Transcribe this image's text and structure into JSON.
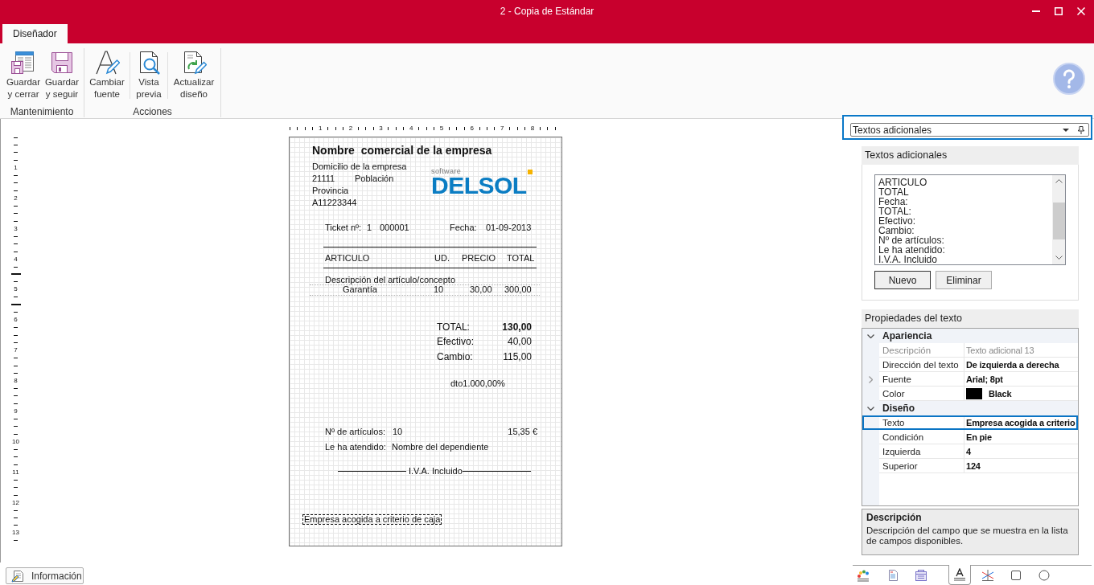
{
  "window": {
    "title": "2 - Copia de Estándar"
  },
  "tabs": [
    {
      "label": "Diseñador",
      "selected": true
    }
  ],
  "ribbon": {
    "groups": [
      {
        "label": "Mantenimiento",
        "buttons": [
          {
            "lines": [
              "Guardar",
              "y cerrar"
            ]
          },
          {
            "lines": [
              "Guardar",
              "y seguir"
            ]
          }
        ]
      },
      {
        "label": "Acciones",
        "buttons": [
          {
            "lines": [
              "Cambiar",
              "fuente"
            ]
          },
          {
            "lines": [
              "Vista",
              "previa"
            ]
          },
          {
            "lines": [
              "Actualizar",
              "diseño"
            ]
          }
        ]
      }
    ]
  },
  "rulers": {
    "horizontal": [
      "1",
      "2",
      "3",
      "4",
      "5",
      "6",
      "7",
      "8"
    ],
    "vertical": [
      "1",
      "2",
      "3",
      "4",
      "5",
      "6",
      "7",
      "8",
      "9",
      "10",
      "11",
      "12",
      "13"
    ]
  },
  "ticket": {
    "company_name": "Nombre  comercial de la empresa",
    "address": "Domicilio de la empresa",
    "postal_code": "21111",
    "city": "Población",
    "province": "Provincia",
    "tax_id": "A11223344",
    "logo": {
      "tagline": "software",
      "wordmark": "DELSOL"
    },
    "ticket_label": "Ticket nº:",
    "series": "1",
    "number": "000001",
    "date_label": "Fecha:",
    "date": "01-09-2013",
    "columns": [
      "ARTICULO",
      "UD.",
      "PRECIO",
      "TOTAL"
    ],
    "lines": [
      {
        "description": "Descripción del artículo/concepto",
        "name": "Garantía",
        "units": "10",
        "price": "30,00",
        "total": "300,00"
      }
    ],
    "totals": [
      {
        "label": "TOTAL:",
        "value": "130,00",
        "bold": true
      },
      {
        "label": "Efectivo:",
        "value": "40,00",
        "bold": false
      },
      {
        "label": "Cambio:",
        "value": "115,00",
        "bold": false
      }
    ],
    "discount": "dto1.000,00%",
    "items_count_label": "Nº de artículos:",
    "items_count": "10",
    "amount": "15,35 €",
    "served_by_label": "Le ha atendido:",
    "served_by": "Nombre del dependiente",
    "tax_note": "I.V.A. Incluido",
    "footer_text": {
      "text": "Empresa acogida a criterio de caja",
      "selected": true
    }
  },
  "panel_selector": {
    "value": "Textos adicionales",
    "highlighted": true
  },
  "additional_texts": {
    "title": "Textos adicionales",
    "items": [
      "ARTICULO",
      "TOTAL",
      "Fecha:",
      "TOTAL:",
      "Efectivo:",
      "Cambio:",
      "Nº de artículos:",
      "Le ha atendido:",
      "I.V.A. Incluido"
    ],
    "buttons": [
      {
        "label": "Nuevo",
        "focused": true
      },
      {
        "label": "Eliminar",
        "focused": false
      }
    ]
  },
  "properties": {
    "title": "Propiedades del texto",
    "categories": [
      {
        "name": "Apariencia",
        "expanded": true,
        "rows": [
          {
            "kind": "text",
            "name": "Descripción",
            "value": "Texto adicional 13",
            "readonly": true,
            "selected": false
          },
          {
            "kind": "text",
            "name": "Dirección del texto",
            "value": "De izquierda a derecha",
            "readonly": false,
            "selected": false
          },
          {
            "kind": "expandable",
            "name": "Fuente",
            "value": "Arial; 8pt",
            "expanded": false,
            "readonly": false,
            "selected": false
          },
          {
            "kind": "color",
            "name": "Color",
            "value": "Black",
            "color": "#000000",
            "readonly": false,
            "selected": false
          }
        ]
      },
      {
        "name": "Diseño",
        "expanded": true,
        "rows": [
          {
            "kind": "text",
            "name": "Texto",
            "value": "Empresa acogida a criterio",
            "readonly": false,
            "selected": true
          },
          {
            "kind": "text",
            "name": "Condición",
            "value": "En pie",
            "readonly": false,
            "selected": false
          },
          {
            "kind": "text",
            "name": "Izquierda",
            "value": "4",
            "readonly": false,
            "selected": false
          },
          {
            "kind": "text",
            "name": "Superior",
            "value": "124",
            "readonly": false,
            "selected": false
          }
        ]
      }
    ]
  },
  "description": {
    "title": "Descripción",
    "text": "Descripción del campo que se muestra en la lista de campos disponibles."
  },
  "info_button": {
    "label": "Información"
  },
  "toolbox": {
    "tools": [
      {
        "selected": false
      },
      {
        "selected": false
      },
      {
        "selected": false
      },
      {
        "selected": true
      },
      {
        "selected": false
      },
      {
        "selected": false
      },
      {
        "selected": false
      }
    ]
  }
}
